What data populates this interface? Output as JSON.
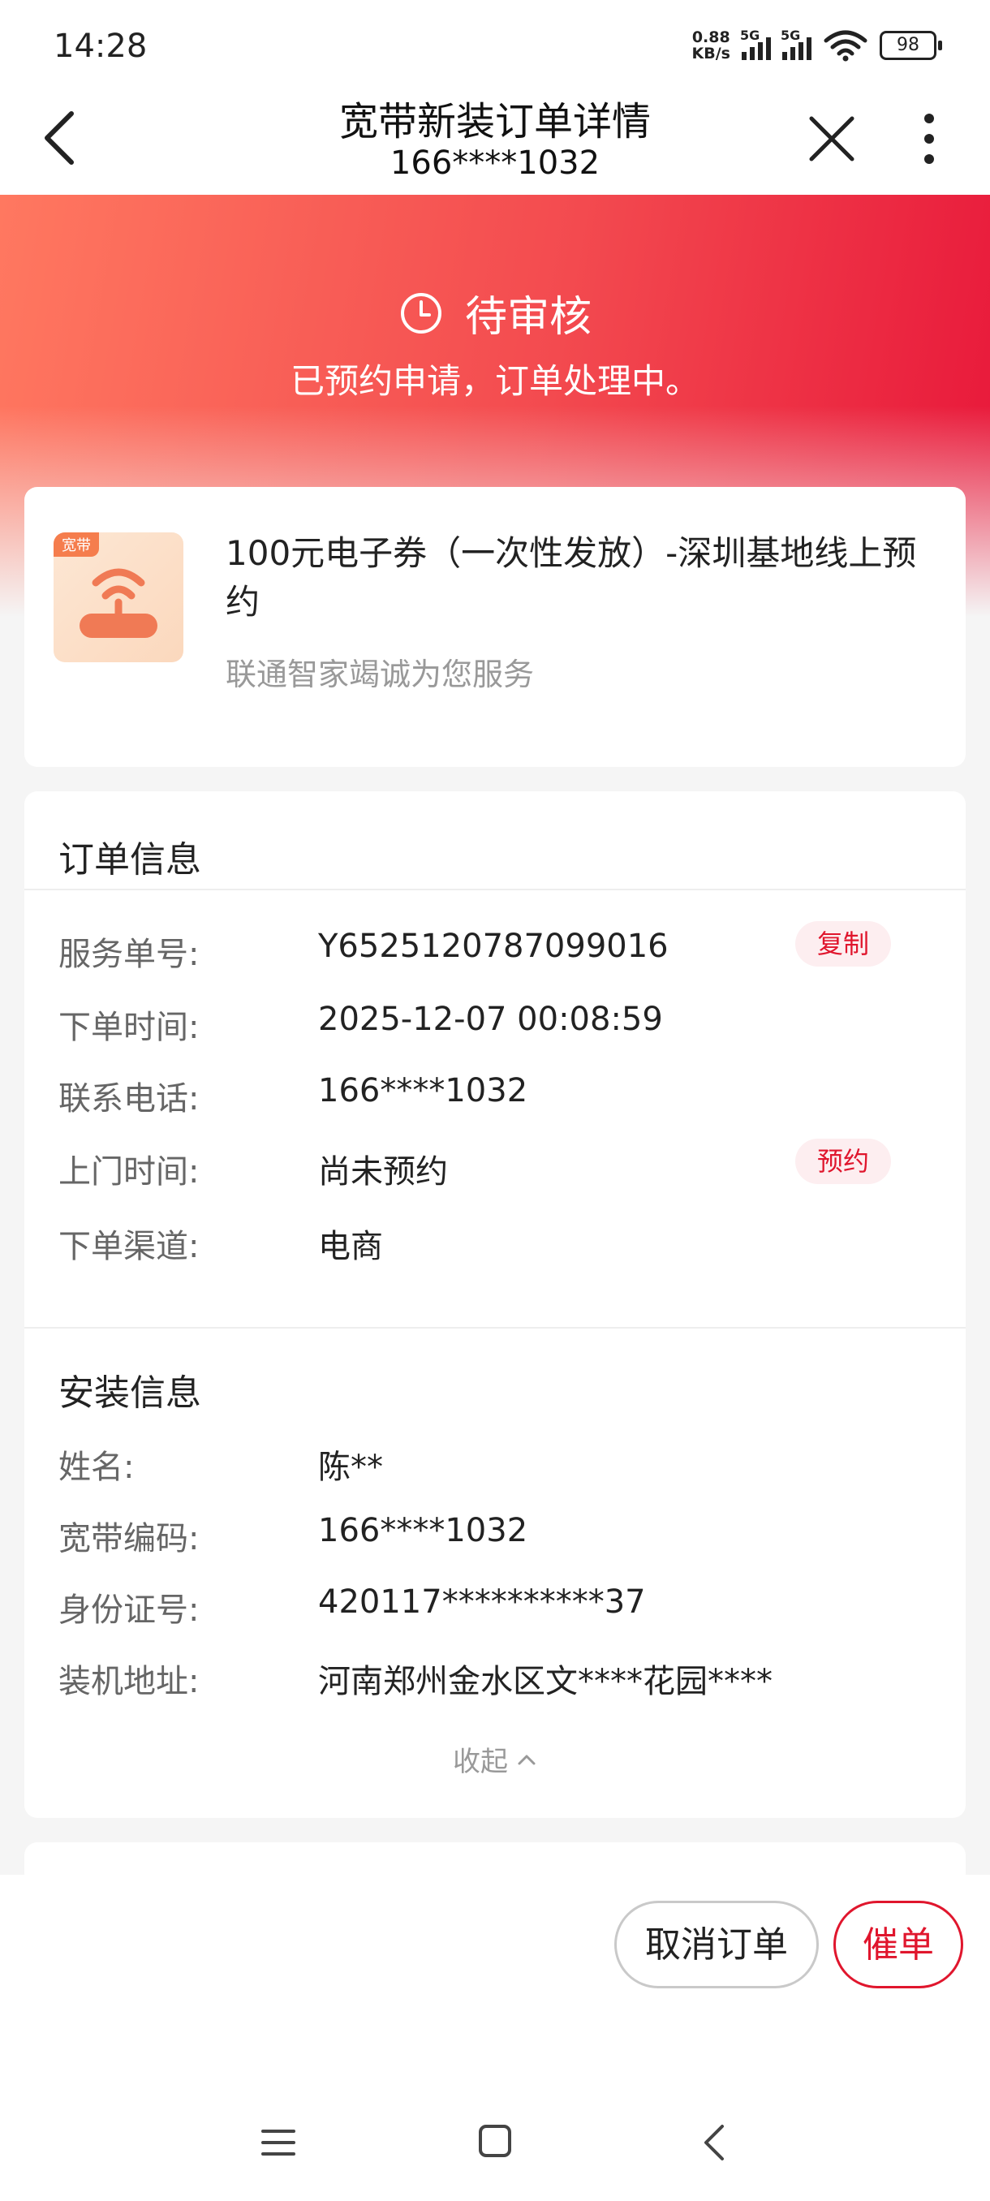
{
  "status_bar": {
    "time": "14:28",
    "net_speed_top": "0.88",
    "net_speed_unit": "KB/s",
    "sim1_label": "5G",
    "sim2_label": "5G",
    "battery": "98"
  },
  "nav": {
    "title": "宽带新装订单详情",
    "subtitle": "166****1032"
  },
  "header": {
    "status": "待审核",
    "description": "已预约申请，订单处理中。"
  },
  "product": {
    "tag": "宽带",
    "title": "100元电子券（一次性发放）-深圳基地线上预约",
    "subtitle": "联通智家竭诚为您服务"
  },
  "order_info": {
    "title": "订单信息",
    "rows": [
      {
        "label": "服务单号:",
        "value": "Y6525120787099016",
        "action": "复制"
      },
      {
        "label": "下单时间:",
        "value": "2025-12-07 00:08:59"
      },
      {
        "label": "联系电话:",
        "value": "166****1032"
      },
      {
        "label": "上门时间:",
        "value": "尚未预约",
        "action": "预约"
      },
      {
        "label": "下单渠道:",
        "value": "电商"
      }
    ]
  },
  "install_info": {
    "title": "安装信息",
    "rows": [
      {
        "label": "姓名:",
        "value": "陈**"
      },
      {
        "label": "宽带编码:",
        "value": "166****1032"
      },
      {
        "label": "身份证号:",
        "value": "420117**********37"
      },
      {
        "label": "装机地址:",
        "value": "河南郑州金水区文****花园****"
      }
    ],
    "collapse_label": "收起"
  },
  "actions": {
    "cancel_label": "取消订单",
    "urge_label": "催单"
  },
  "colors": {
    "accent": "#e0162d",
    "header_start": "#ff7860",
    "header_end": "#e8173a"
  }
}
